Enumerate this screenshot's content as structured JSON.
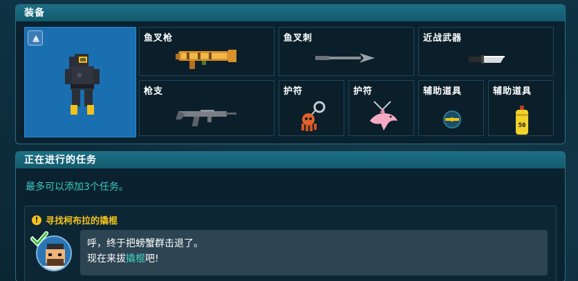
{
  "equipment": {
    "title": "装备",
    "slots": [
      {
        "label": "鱼叉枪",
        "icon": "harpoon-gun-icon"
      },
      {
        "label": "鱼叉刺",
        "icon": "harpoon-spear-icon"
      },
      {
        "label": "近战武器",
        "icon": "knife-icon"
      },
      {
        "label": "枪支",
        "icon": "rifle-icon"
      },
      {
        "label": "护符",
        "icon": "octopus-charm-icon"
      },
      {
        "label": "护符",
        "icon": "dolphin-charm-icon"
      },
      {
        "label": "辅助道具",
        "icon": "net-orb-icon"
      },
      {
        "label": "辅助道具",
        "icon": "oxygen-tank-icon"
      }
    ],
    "tank_number": "50"
  },
  "missions": {
    "title": "正在进行的任务",
    "hint": "最多可以添加3个任务。",
    "quest": {
      "title": "寻找柯布拉的撬棍",
      "line1": "呼，终于把螃蟹群击退了。",
      "line2_prefix": "现在来拔",
      "line2_highlight": "撬棍",
      "line2_suffix": "吧!"
    }
  }
}
